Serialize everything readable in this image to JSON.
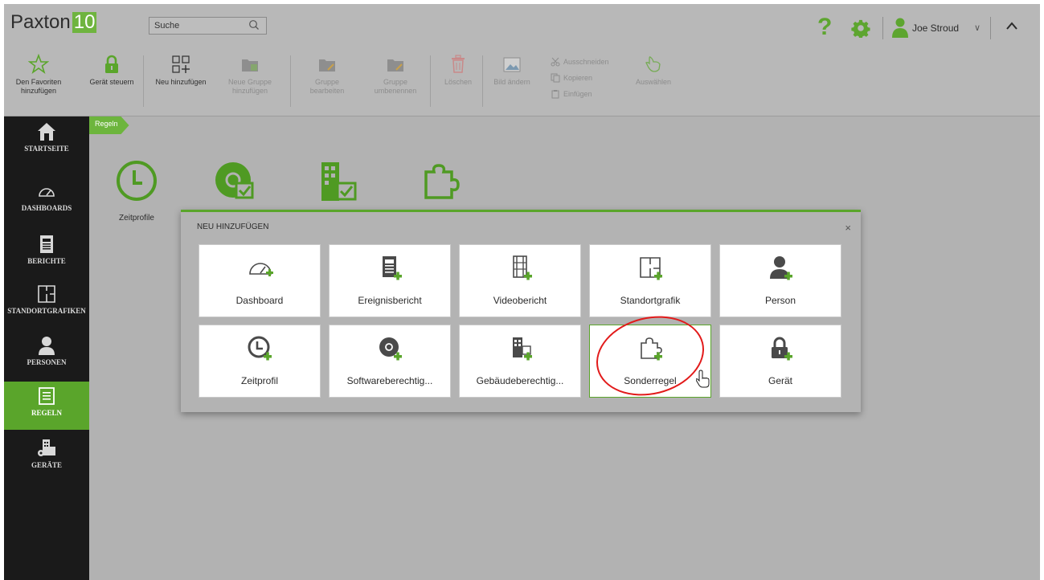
{
  "app": {
    "brand": "Paxton",
    "version": "10"
  },
  "search": {
    "placeholder": "Suche"
  },
  "header": {
    "help_label": "?",
    "user_name": "Joe Stroud",
    "user_chevron": "∨"
  },
  "toolbar": {
    "items": [
      {
        "label": "Den Favoriten hinzufügen",
        "icon": "star-icon",
        "enabled": true
      },
      {
        "label": "Gerät steuern",
        "icon": "padlock-icon",
        "enabled": true
      },
      {
        "label": "Neu hinzufügen",
        "icon": "add-grid-icon",
        "enabled": true
      },
      {
        "label": "Neue Gruppe hinzufügen",
        "icon": "folder-add-icon",
        "enabled": false
      },
      {
        "label": "Gruppe bearbeiten",
        "icon": "folder-edit-icon",
        "enabled": false
      },
      {
        "label": "Gruppe umbenennen",
        "icon": "folder-rename-icon",
        "enabled": false
      },
      {
        "label": "Löschen",
        "icon": "trash-icon",
        "enabled": false
      },
      {
        "label": "Bild ändern",
        "icon": "image-icon",
        "enabled": false
      },
      {
        "label": "Auswählen",
        "icon": "hand-pointer-icon",
        "enabled": false
      }
    ],
    "clipboard": [
      {
        "label": "Ausschneiden",
        "icon": "scissors-icon"
      },
      {
        "label": "Kopieren",
        "icon": "copy-icon"
      },
      {
        "label": "Einfügen",
        "icon": "paste-icon"
      }
    ]
  },
  "sidebar": {
    "items": [
      {
        "label": "STARTSEITE",
        "icon": "home-icon",
        "active": false
      },
      {
        "label": "DASHBOARDS",
        "icon": "gauge-icon",
        "active": false
      },
      {
        "label": "BERICHTE",
        "icon": "report-icon",
        "active": false
      },
      {
        "label": "STANDORTGRAFIKEN",
        "icon": "floorplan-icon",
        "active": false
      },
      {
        "label": "PERSONEN",
        "icon": "person-icon",
        "active": false
      },
      {
        "label": "REGELN",
        "icon": "rules-icon",
        "active": true
      },
      {
        "label": "GERÄTE",
        "icon": "devices-icon",
        "active": false
      }
    ]
  },
  "breadcrumb": {
    "current": "Regeln"
  },
  "background": {
    "items": [
      {
        "label": "Zeitprofile",
        "icon": "clock-icon"
      },
      {
        "label": "",
        "icon": "software-permission-icon"
      },
      {
        "label": "",
        "icon": "building-permission-icon"
      },
      {
        "label": "",
        "icon": "puzzle-icon"
      }
    ]
  },
  "modal": {
    "title": "NEU HINZUFÜGEN",
    "close_label": "×",
    "tiles": [
      {
        "label": "Dashboard",
        "icon": "gauge-add-icon"
      },
      {
        "label": "Ereignisbericht",
        "icon": "event-report-add-icon"
      },
      {
        "label": "Videobericht",
        "icon": "video-report-add-icon"
      },
      {
        "label": "Standortgrafik",
        "icon": "floorplan-add-icon"
      },
      {
        "label": "Person",
        "icon": "person-add-icon"
      },
      {
        "label": "Zeitprofil",
        "icon": "clock-add-icon"
      },
      {
        "label": "Softwareberechtig...",
        "icon": "software-permission-add-icon"
      },
      {
        "label": "Gebäudeberechtig...",
        "icon": "building-permission-add-icon"
      },
      {
        "label": "Sonderregel",
        "icon": "puzzle-add-icon",
        "selected": true
      },
      {
        "label": "Gerät",
        "icon": "device-add-icon"
      }
    ]
  },
  "colors": {
    "accent": "#5aa52b",
    "sidebar_bg": "#1a1a1a",
    "overlay": "#b2b2b2",
    "highlight_circle": "#e21b1b"
  }
}
